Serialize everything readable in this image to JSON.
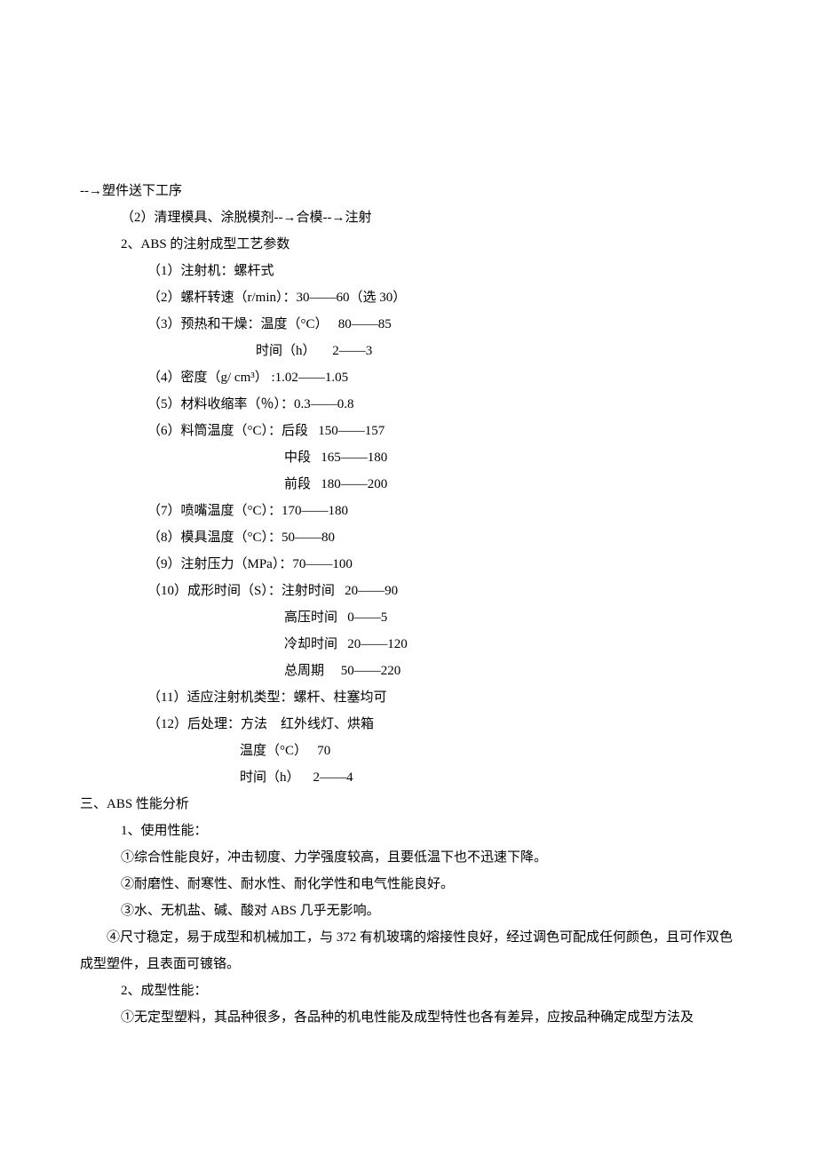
{
  "lines": {
    "l1": "--→塑件送下工序",
    "l2": "（2）清理模具、涂脱模剂--→合模--→注射",
    "l3": "2、ABS 的注射成型工艺参数",
    "l4": "（1）注射机：螺杆式",
    "l5": "（2）螺杆转速（r/min）：30——60（选 30）",
    "l6": "（3）预热和干燥：温度（°C）   80——85",
    "l7": "时间（h）     2——3",
    "l8": "（4）密度（g/ cm³） :1.02——1.05",
    "l9": "（5）材料收缩率（％）：0.3——0.8",
    "l10": "（6）料筒温度（°C）：后段   150——157",
    "l11": "中段   165——180",
    "l12": "前段   180——200",
    "l13": "（7）喷嘴温度（°C）：170——180",
    "l14": "（8）模具温度（°C）：50——80",
    "l15": "（9）注射压力（MPa）：70——100",
    "l16": "（10）成形时间（S）：注射时间   20——90",
    "l17": "高压时间   0——5",
    "l18": "冷却时间   20——120",
    "l19": "总周期     50——220",
    "l20": "（11）适应注射机类型：螺杆、柱塞均可",
    "l21": "（12）后处理：方法    红外线灯、烘箱",
    "l22": "温度（°C）   70",
    "l23": "时间（h）    2——4",
    "l24": "三、ABS 性能分析",
    "l25": "1、使用性能：",
    "l26": "①综合性能良好，冲击韧度、力学强度较高，且要低温下也不迅速下降。",
    "l27": "②耐磨性、耐寒性、耐水性、耐化学性和电气性能良好。",
    "l28": "③水、无机盐、碱、酸对 ABS 几乎无影响。",
    "l29": "④尺寸稳定，易于成型和机械加工，与 372 有机玻璃的熔接性良好，经过调色可配成任何颜色，且可作双色成型塑件，且表面可镀铬。",
    "l30": "2、成型性能：",
    "l31": "①无定型塑料，其品种很多，各品种的机电性能及成型特性也各有差异，应按品种确定成型方法及"
  }
}
